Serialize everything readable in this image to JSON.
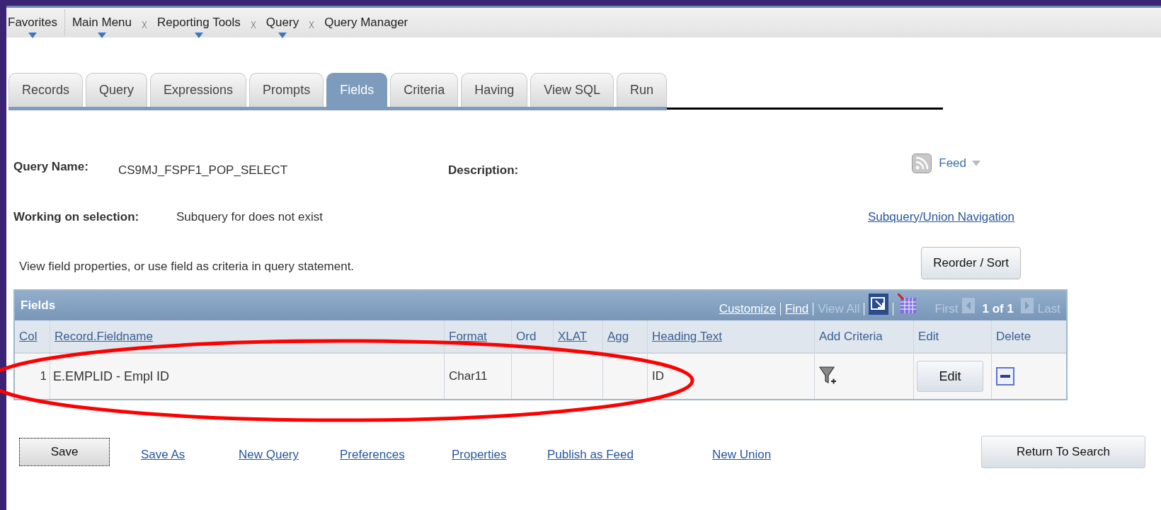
{
  "breadcrumbs": [
    {
      "label": "Favorites",
      "has_menu": true
    },
    {
      "label": "Main Menu",
      "has_menu": true
    },
    {
      "label": "Reporting Tools",
      "has_menu": true
    },
    {
      "label": "Query",
      "has_menu": true
    },
    {
      "label": "Query Manager",
      "has_menu": false
    }
  ],
  "tabs": [
    {
      "label": "Records",
      "selected": false
    },
    {
      "label": "Query",
      "selected": false
    },
    {
      "label": "Expressions",
      "selected": false
    },
    {
      "label": "Prompts",
      "selected": false
    },
    {
      "label": "Fields",
      "selected": true
    },
    {
      "label": "Criteria",
      "selected": false
    },
    {
      "label": "Having",
      "selected": false
    },
    {
      "label": "View SQL",
      "selected": false
    },
    {
      "label": "Run",
      "selected": false
    }
  ],
  "query_name": {
    "label": "Query Name:",
    "value": "CS9MJ_FSPF1_POP_SELECT"
  },
  "description": {
    "label": "Description:"
  },
  "feed": {
    "label": "Feed"
  },
  "working_on": {
    "label": "Working on selection:",
    "value": "Subquery for does not exist"
  },
  "subquery_link": "Subquery/Union Navigation",
  "instructions": "View field properties, or use field as criteria in query statement.",
  "reorder_button": "Reorder / Sort",
  "grid": {
    "title": "Fields",
    "tools": [
      {
        "label": "Customize",
        "disabled": false
      },
      {
        "label": "Find",
        "disabled": false
      },
      {
        "label": "View All",
        "disabled": true
      }
    ],
    "pager": {
      "first": "First",
      "range": "1 of 1",
      "last": "Last",
      "first_disabled": true,
      "last_disabled": true
    },
    "columns": [
      {
        "label": "Col",
        "link": true
      },
      {
        "label": "Record.Fieldname",
        "link": true
      },
      {
        "label": "Format",
        "link": true
      },
      {
        "label": "Ord",
        "link": false
      },
      {
        "label": "XLAT",
        "link": true
      },
      {
        "label": "Agg",
        "link": true
      },
      {
        "label": "Heading Text",
        "link": true
      },
      {
        "label": "Add Criteria",
        "link": false
      },
      {
        "label": "Edit",
        "link": false
      },
      {
        "label": "Delete",
        "link": false
      }
    ],
    "rows": [
      {
        "col": "1",
        "fieldname": "E.EMPLID - Empl ID",
        "format": "Char11",
        "heading_text": "ID",
        "edit_button": "Edit",
        "highlighted": true
      }
    ]
  },
  "footer": {
    "save": "Save",
    "links": [
      "Save As",
      "New Query",
      "Preferences",
      "Properties",
      "Publish as Feed",
      "New Union"
    ],
    "return_button": "Return To Search"
  }
}
